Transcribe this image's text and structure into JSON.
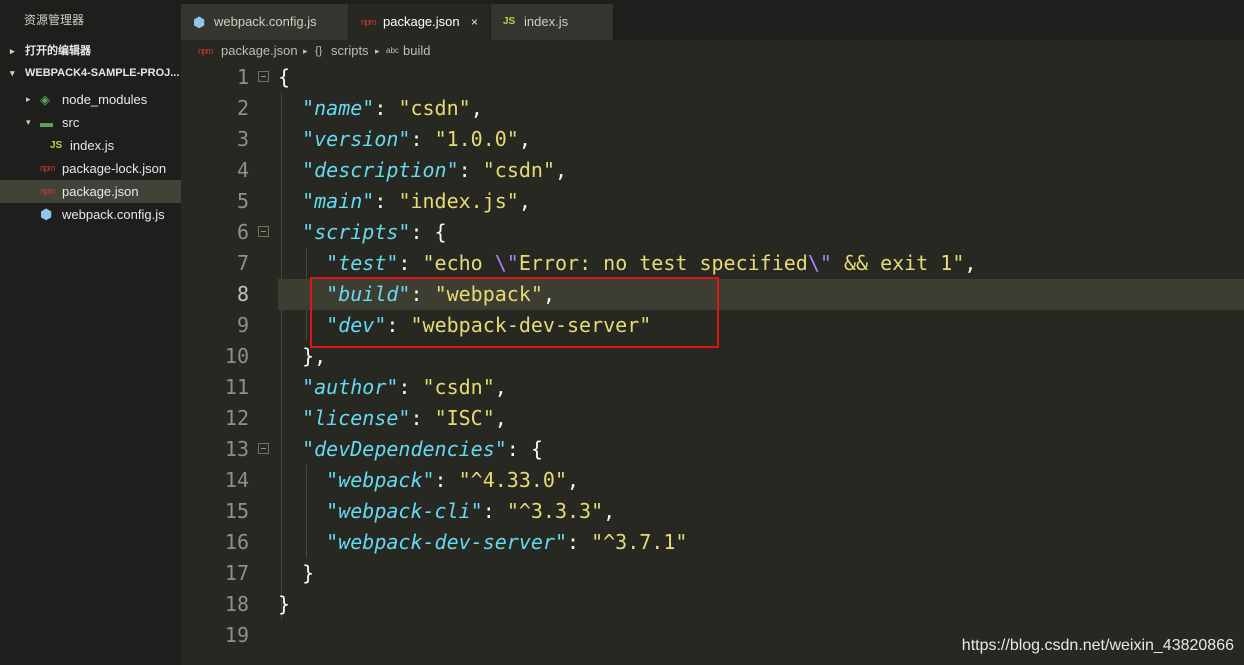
{
  "sidebar": {
    "title": "资源管理器",
    "open_editors_label": "打开的编辑器",
    "project_label": "WEBPACK4-SAMPLE-PROJ...",
    "items": [
      {
        "label": "node_modules",
        "icon": "node-modules-folder-icon",
        "twisty": "▸"
      },
      {
        "label": "src",
        "icon": "folder-icon",
        "twisty": "▾"
      },
      {
        "label": "index.js",
        "icon": "js-file-icon",
        "icon_text": "JS"
      },
      {
        "label": "package-lock.json",
        "icon": "npm-file-icon",
        "icon_text": "npm"
      },
      {
        "label": "package.json",
        "icon": "npm-file-icon",
        "icon_text": "npm"
      },
      {
        "label": "webpack.config.js",
        "icon": "webpack-hex-icon"
      }
    ]
  },
  "tabs": [
    {
      "label": "webpack.config.js",
      "icon": "webpack-hex-icon"
    },
    {
      "label": "package.json",
      "icon": "npm-file-icon",
      "icon_text": "npm",
      "active": true,
      "close": "×"
    },
    {
      "label": "index.js",
      "icon": "js-file-icon",
      "icon_text": "JS"
    }
  ],
  "breadcrumb": {
    "file": "package.json",
    "scripts_icon": "{}",
    "scripts": "scripts",
    "build_icon": "abc",
    "build": "build",
    "separator": "▸"
  },
  "editor": {
    "line_numbers": [
      "1",
      "2",
      "3",
      "4",
      "5",
      "6",
      "7",
      "8",
      "9",
      "10",
      "11",
      "12",
      "13",
      "14",
      "15",
      "16",
      "17",
      "18",
      "19"
    ],
    "current_line": 8
  },
  "watermark": "https://blog.csdn.net/weixin_43820866",
  "colors": {
    "background": "#272822",
    "key": "#66d9ef",
    "string": "#e6db74",
    "escape": "#ae81ff",
    "highlight_box": "#e01414"
  }
}
